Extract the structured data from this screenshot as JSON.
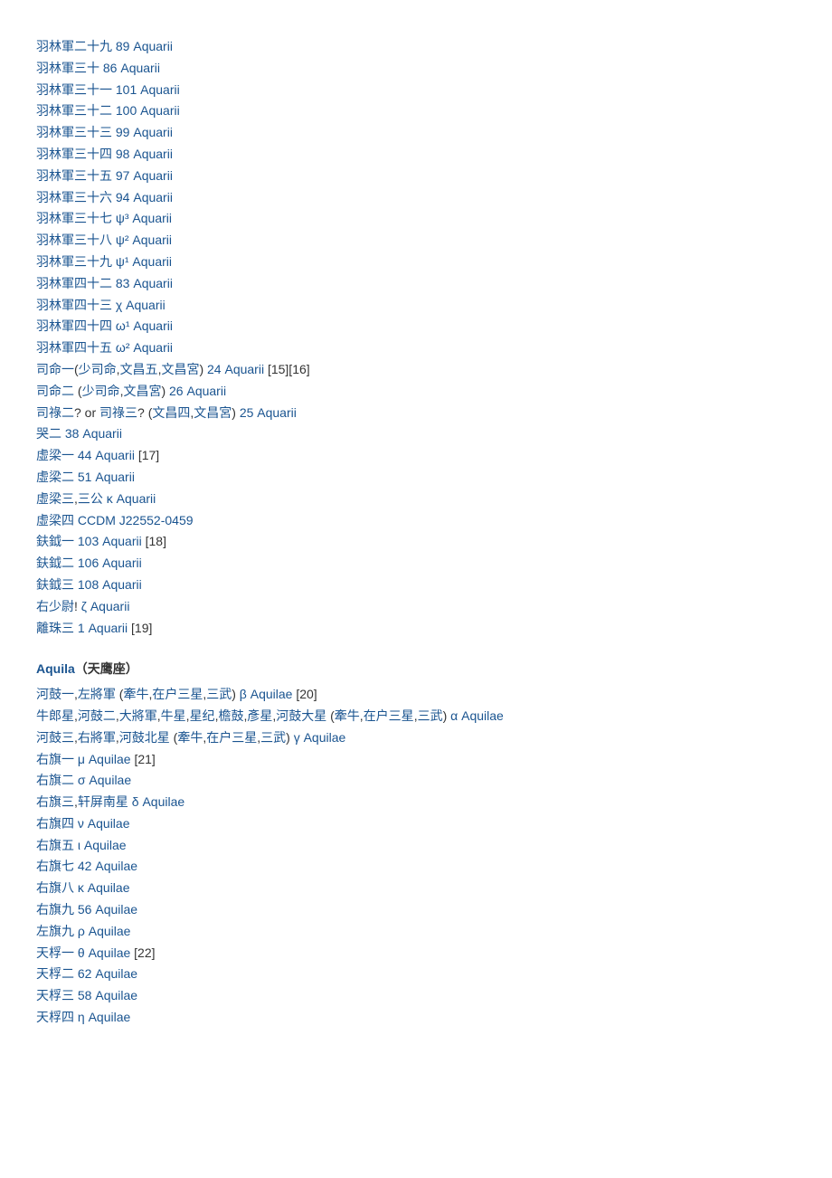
{
  "aquarius_entries": [
    {
      "chinese": "羽林軍二十九",
      "western": "89 Aquarii",
      "refs": ""
    },
    {
      "chinese": "羽林軍三十",
      "western": "86 Aquarii",
      "refs": ""
    },
    {
      "chinese": "羽林軍三十一",
      "western": "101 Aquarii",
      "refs": ""
    },
    {
      "chinese": "羽林軍三十二",
      "western": "100 Aquarii",
      "refs": ""
    },
    {
      "chinese": "羽林軍三十三",
      "western": "99 Aquarii",
      "refs": ""
    },
    {
      "chinese": "羽林軍三十四",
      "western": "98 Aquarii",
      "refs": ""
    },
    {
      "chinese": "羽林軍三十五",
      "western": "97 Aquarii",
      "refs": ""
    },
    {
      "chinese": "羽林軍三十六",
      "western": "94 Aquarii",
      "refs": ""
    },
    {
      "chinese": "羽林軍三十七",
      "western": "ψ³ Aquarii",
      "refs": ""
    },
    {
      "chinese": "羽林軍三十八",
      "western": "ψ² Aquarii",
      "refs": ""
    },
    {
      "chinese": "羽林軍三十九",
      "western": "ψ¹ Aquarii",
      "refs": ""
    },
    {
      "chinese": "羽林軍四十二",
      "western": "83 Aquarii",
      "refs": ""
    },
    {
      "chinese": "羽林軍四十三",
      "western": "χ Aquarii",
      "refs": ""
    },
    {
      "chinese": "羽林軍四十四",
      "western": "ω¹ Aquarii",
      "refs": ""
    },
    {
      "chinese": "羽林軍四十五",
      "western": "ω² Aquarii",
      "refs": ""
    },
    {
      "chinese_parts": [
        "司命一",
        "(",
        "少司命",
        ",",
        "文昌五",
        ",",
        "文昌宮",
        ") "
      ],
      "western": "24 Aquarii",
      "refs": " [15][16]"
    },
    {
      "chinese_parts": [
        "司命二",
        " (",
        "少司命",
        ",",
        "文昌宮",
        ") "
      ],
      "western": "26 Aquarii",
      "refs": ""
    },
    {
      "chinese_parts": [
        "司祿二",
        "? or ",
        "司祿三",
        "? (",
        "文昌四",
        ",",
        "文昌宮",
        ") "
      ],
      "western": "25 Aquarii",
      "refs": ""
    },
    {
      "chinese": "哭二",
      "western": "38 Aquarii",
      "refs": ""
    },
    {
      "chinese": "虛梁一",
      "western": "44 Aquarii",
      "refs": " [17]"
    },
    {
      "chinese": "虛梁二",
      "western": "51 Aquarii",
      "refs": ""
    },
    {
      "chinese_parts": [
        "虛梁三",
        ",",
        "三公",
        " "
      ],
      "western": "κ Aquarii",
      "refs": ""
    },
    {
      "chinese": "虛梁四",
      "western": "CCDM J22552-0459",
      "refs": ""
    },
    {
      "chinese": "鈇鉞一",
      "western": "103 Aquarii",
      "refs": " [18]"
    },
    {
      "chinese": "鈇鉞二",
      "western": "106 Aquarii",
      "refs": ""
    },
    {
      "chinese": "鈇鉞三",
      "western": "108 Aquarii",
      "refs": ""
    },
    {
      "chinese_parts": [
        "右少尉",
        "! "
      ],
      "western": "ζ Aquarii",
      "refs": ""
    },
    {
      "chinese": "離珠三",
      "western": "1 Aquarii",
      "refs": " [19]"
    }
  ],
  "aquila_heading": {
    "name": "Aquila",
    "suffix": "（天鹰座）"
  },
  "aquila_entries": [
    {
      "chinese_parts": [
        "河鼓一",
        ",",
        "左將軍",
        " (",
        "牽牛",
        ",",
        "在户三星",
        ",",
        "三武",
        ") "
      ],
      "western": "β Aquilae",
      "refs": " [20]"
    },
    {
      "chinese_parts": [
        "牛郎星",
        ",",
        "河鼓二",
        ",",
        "大將軍",
        ",",
        "牛星",
        ",",
        "星纪",
        ",",
        "檐鼓",
        ",",
        "彥星",
        ",",
        "河鼓大星",
        " (",
        "牽牛",
        ",",
        "在户三星",
        ",",
        "三武",
        ") "
      ],
      "western": "α Aquilae",
      "refs": ""
    },
    {
      "chinese_parts": [
        "河鼓三",
        ",",
        "右將軍",
        ",",
        "河鼓北星",
        " (",
        "牽牛",
        ",",
        "在户三星",
        ",",
        "三武",
        ") "
      ],
      "western": "γ Aquilae",
      "refs": ""
    },
    {
      "chinese": "右旗一",
      "western": "μ Aquilae",
      "refs": " [21]"
    },
    {
      "chinese": "右旗二",
      "western": "σ Aquilae",
      "refs": ""
    },
    {
      "chinese_parts": [
        "右旗三",
        ",",
        "轩屏南星",
        " "
      ],
      "western": "δ Aquilae",
      "refs": ""
    },
    {
      "chinese": "右旗四",
      "western": "ν Aquilae",
      "refs": ""
    },
    {
      "chinese": "右旗五",
      "western": "ι Aquilae",
      "refs": ""
    },
    {
      "chinese": "右旗七",
      "western": "42 Aquilae",
      "refs": ""
    },
    {
      "chinese": "右旗八",
      "western": "κ Aquilae",
      "refs": ""
    },
    {
      "chinese": "右旗九",
      "western": "56 Aquilae",
      "refs": ""
    },
    {
      "chinese": "左旗九",
      "western": "ρ Aquilae",
      "refs": ""
    },
    {
      "chinese": "天桴一",
      "western": "θ Aquilae",
      "refs": " [22]"
    },
    {
      "chinese": "天桴二",
      "western": "62 Aquilae",
      "refs": ""
    },
    {
      "chinese": "天桴三",
      "western": "58 Aquilae",
      "refs": ""
    },
    {
      "chinese": "天桴四",
      "western": "η Aquilae",
      "refs": ""
    }
  ]
}
